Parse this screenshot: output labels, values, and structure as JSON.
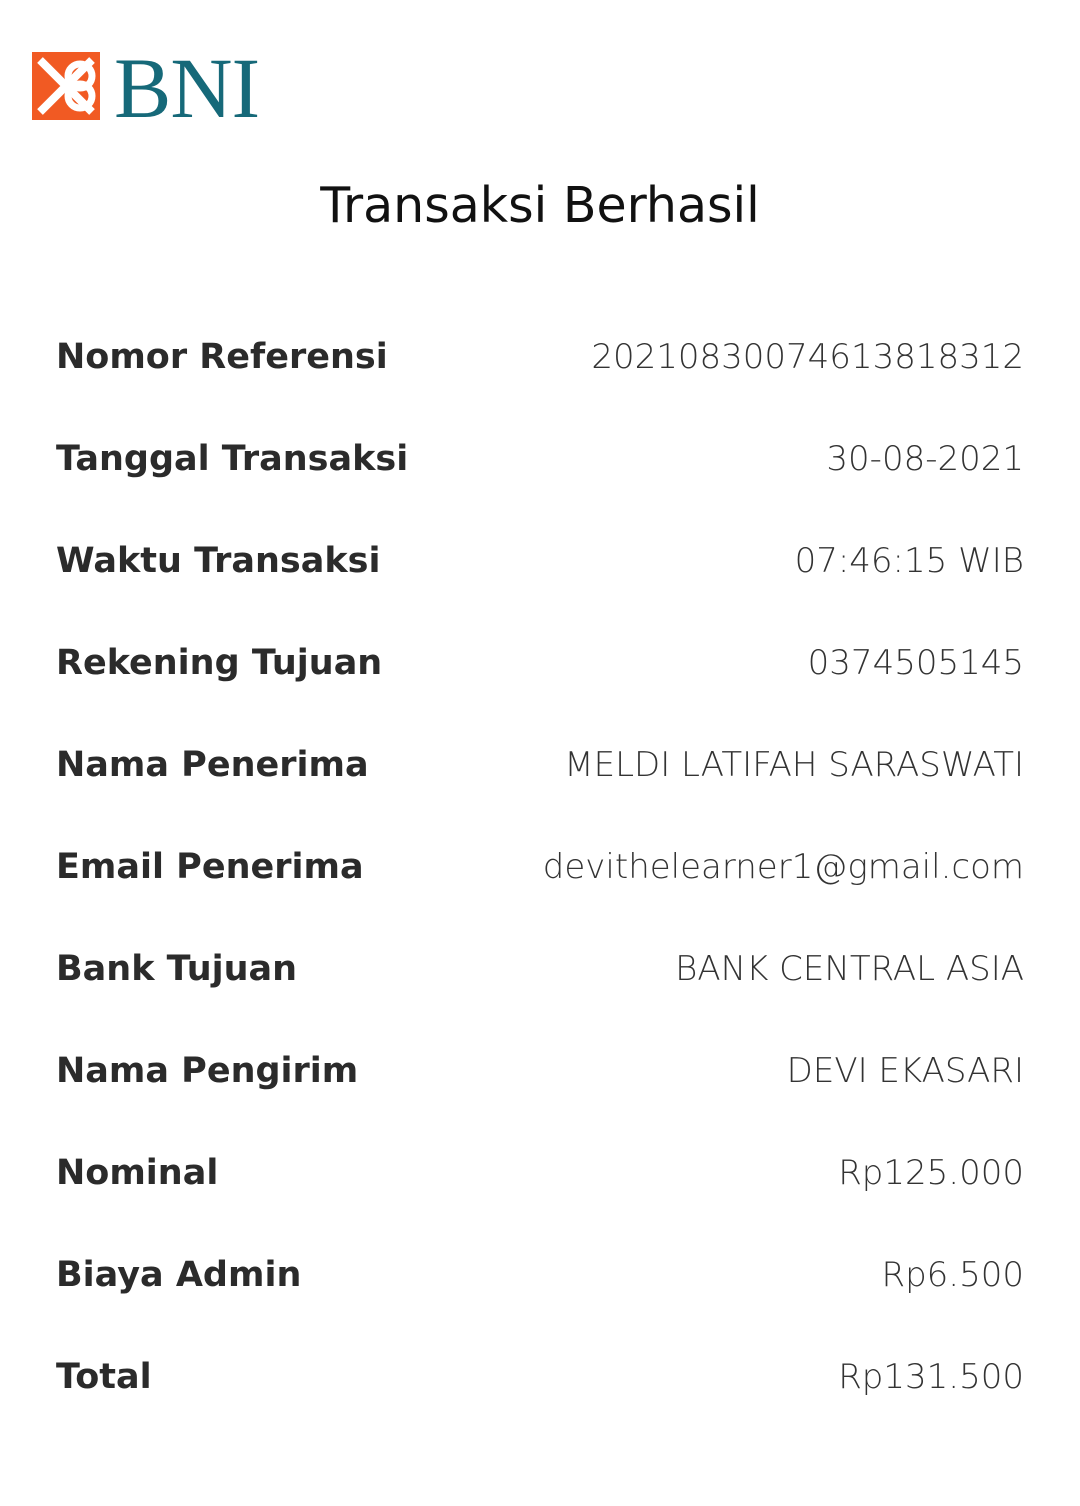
{
  "brand": {
    "logo_text": "BNI",
    "text_color": "#166979",
    "mark_color": "#f15a23"
  },
  "title": "Transaksi Berhasil",
  "rows": [
    {
      "label": "Nomor Referensi",
      "value": "20210830074613818312"
    },
    {
      "label": "Tanggal Transaksi",
      "value": "30-08-2021"
    },
    {
      "label": "Waktu Transaksi",
      "value": "07:46:15 WIB"
    },
    {
      "label": "Rekening Tujuan",
      "value": "0374505145"
    },
    {
      "label": "Nama Penerima",
      "value": "MELDI LATIFAH SARASWATI"
    },
    {
      "label": "Email Penerima",
      "value": "devithelearner1@gmail.com"
    },
    {
      "label": "Bank Tujuan",
      "value": "BANK CENTRAL ASIA"
    },
    {
      "label": "Nama Pengirim",
      "value": "DEVI EKASARI"
    },
    {
      "label": "Nominal",
      "value": "Rp125.000"
    },
    {
      "label": "Biaya Admin",
      "value": "Rp6.500"
    },
    {
      "label": "Total",
      "value": "Rp131.500"
    }
  ]
}
